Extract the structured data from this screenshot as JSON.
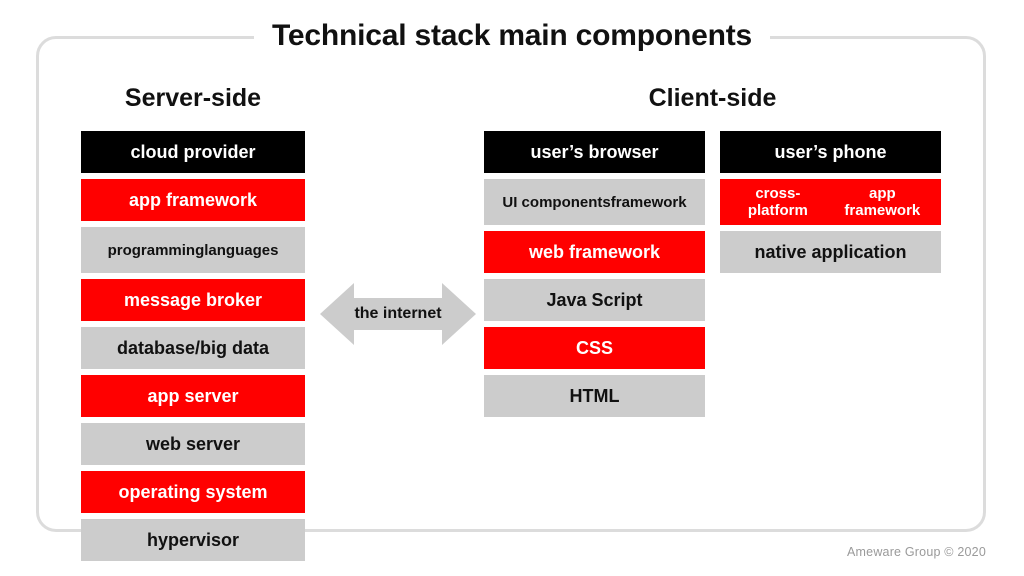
{
  "title": "Technical stack main components",
  "headings": {
    "server": "Server-side",
    "client": "Client-side"
  },
  "connector": {
    "label": "the internet",
    "icon": "double-arrow-horizontal-icon",
    "color": "#cccccc"
  },
  "footer": "Ameware Group © 2020",
  "colors": {
    "dark": "#000000",
    "red": "#ff0000",
    "gray": "#cccccc",
    "frame": "#dcdcdc",
    "text_dark": "#111111",
    "text_light": "#ffffff",
    "footer_text": "#9a9a9a"
  },
  "columns": {
    "server": {
      "items": [
        {
          "label": "cloud provider",
          "style": "dark"
        },
        {
          "label": "app framework",
          "style": "red"
        },
        {
          "label": "programming",
          "label2": "languages",
          "style": "gray"
        },
        {
          "label": "message broker",
          "style": "red"
        },
        {
          "label": "database/big data",
          "style": "gray"
        },
        {
          "label": "app server",
          "style": "red"
        },
        {
          "label": "web server",
          "style": "gray"
        },
        {
          "label": "operating system",
          "style": "red"
        },
        {
          "label": "hypervisor",
          "style": "gray"
        }
      ]
    },
    "browser": {
      "items": [
        {
          "label": "user’s browser",
          "style": "dark"
        },
        {
          "label": "UI components",
          "label2": "framework",
          "style": "gray"
        },
        {
          "label": "web framework",
          "style": "red"
        },
        {
          "label": "Java Script",
          "style": "gray"
        },
        {
          "label": "CSS",
          "style": "red"
        },
        {
          "label": "HTML",
          "style": "gray"
        }
      ]
    },
    "phone": {
      "items": [
        {
          "label": "user’s phone",
          "style": "dark"
        },
        {
          "label": "cross-platform",
          "label2": "app framework",
          "style": "red"
        },
        {
          "label": "native application",
          "style": "gray"
        }
      ]
    }
  }
}
